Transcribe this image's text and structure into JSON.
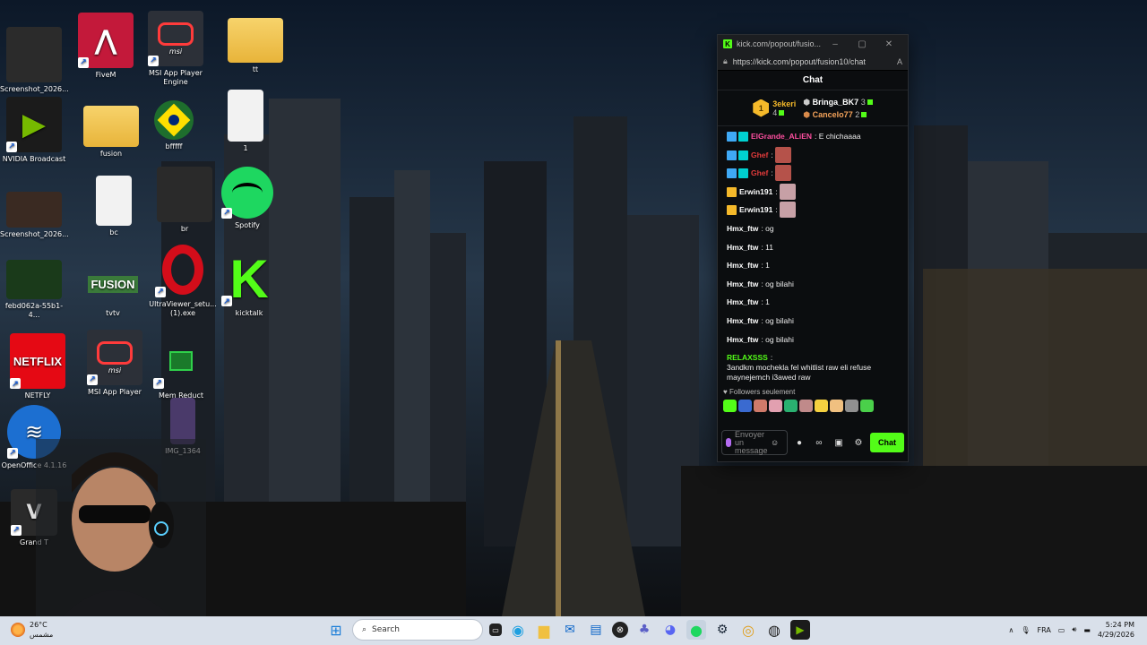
{
  "desktop": {
    "icons": [
      {
        "label": "Screenshot_2026...",
        "color": "#2b2b2b"
      },
      {
        "label": "FiveM",
        "color": "#c3193a"
      },
      {
        "label": "MSI App Player Engine",
        "color": "#2c3038"
      },
      {
        "label": "tt",
        "color": "#f0c040"
      },
      {
        "label": "NVIDIA Broadcast",
        "color": "#1b1b1b"
      },
      {
        "label": "fusion",
        "color": "#f0c040"
      },
      {
        "label": "bfffff",
        "color": "#1e6e2d"
      },
      {
        "label": "1",
        "color": "#f2f2f2"
      },
      {
        "label": "Screenshot_2026...",
        "color": "#3a2a22"
      },
      {
        "label": "bc",
        "color": "#f2f2f2"
      },
      {
        "label": "br",
        "color": "#2a2a2a"
      },
      {
        "label": "Spotify",
        "color": "#1ed760"
      },
      {
        "label": "febd062a-55b1-4...",
        "color": "#1a3a1a"
      },
      {
        "label": "tvtv",
        "color": "#2a2a2a"
      },
      {
        "label": "UltraViewer_setu... (1).exe",
        "color": "#d40d1a"
      },
      {
        "label": "kicktalk",
        "color": "#53fc18"
      },
      {
        "label": "NETFLY",
        "color": "#e50914"
      },
      {
        "label": "MSI App Player",
        "color": "#2c3038"
      },
      {
        "label": "Mem Reduct",
        "color": "#1a7a2a"
      },
      {
        "label": "OpenOffice 4.1.16",
        "color": "#1c6fd1"
      },
      {
        "label": "IMG_1364",
        "color": "#4a3a6a"
      },
      {
        "label": "Grand T",
        "color": "#2a2a2a"
      }
    ],
    "fusion_logo_text": "FUSION",
    "netflix_logo_text": "NETFLIX",
    "msi_text": "msi"
  },
  "chat_window": {
    "title": "kick.com/popout/fusio...",
    "url": "https://kick.com/popout/fusion10/chat",
    "heading": "Chat",
    "top_gifters": {
      "first": {
        "name": "3ekeri",
        "count": "4",
        "rank": "1"
      },
      "second": {
        "name": "Bringa_BK7",
        "count": "3"
      },
      "third": {
        "name": "Cancelo77",
        "count": "2"
      }
    },
    "messages": [
      {
        "user": "ElGrande_ALiEN",
        "text": "E chichaaaa",
        "color": "#ff4fa0",
        "badges": [
          "#3fa9f5",
          "#00d1d1"
        ]
      },
      {
        "user": "Ghef",
        "text": "",
        "color": "#e23b3b",
        "badges": [
          "#3fa9f5",
          "#00d1d1"
        ],
        "emote": "#b5524a"
      },
      {
        "user": "Ghef",
        "text": "",
        "color": "#e23b3b",
        "badges": [
          "#3fa9f5",
          "#00d1d1"
        ],
        "emote": "#b5524a"
      },
      {
        "user": "Erwin191",
        "text": "",
        "color": "#ffffff",
        "badges": [
          "#f5b92a"
        ],
        "emote": "#c7a0a6"
      },
      {
        "user": "Erwin191",
        "text": "",
        "color": "#ffffff",
        "badges": [
          "#f5b92a"
        ],
        "emote": "#c7a0a6"
      },
      {
        "user": "Hmx_ftw",
        "text": "og",
        "color": "#ffffff",
        "badges": []
      },
      {
        "user": "Hmx_ftw",
        "text": "11",
        "color": "#ffffff",
        "badges": []
      },
      {
        "user": "Hmx_ftw",
        "text": "1",
        "color": "#ffffff",
        "badges": []
      },
      {
        "user": "Hmx_ftw",
        "text": "og bilahi",
        "color": "#ffffff",
        "badges": []
      },
      {
        "user": "Hmx_ftw",
        "text": "1",
        "color": "#ffffff",
        "badges": []
      },
      {
        "user": "Hmx_ftw",
        "text": "og bilahi",
        "color": "#ffffff",
        "badges": []
      },
      {
        "user": "Hmx_ftw",
        "text": "og bilahi",
        "color": "#ffffff",
        "badges": []
      },
      {
        "user": "RELAXSSS",
        "text": "3andkm mochekla fel whitlist raw eli refuse maynejemch i3awed raw",
        "color": "#53fc18",
        "badges": []
      }
    ],
    "followers_only": "Followers seulement",
    "emote_colors": [
      "#53fc18",
      "#3a6ad0",
      "#d07a6a",
      "#e2a0b0",
      "#2ab070",
      "#c08a8a",
      "#f5d040",
      "#f0c080",
      "#909090",
      "#4ad04a"
    ],
    "input_placeholder": "Envoyer un message",
    "send_label": "Chat"
  },
  "taskbar": {
    "weather_temp": "26°C",
    "weather_desc": "مشمس",
    "search_placeholder": "Search",
    "language": "FRA",
    "time": "5:24 PM",
    "date": "4/29/2026"
  },
  "colors": {
    "kick_green": "#53fc18",
    "taskbar_bg": "#d9e0ea"
  }
}
